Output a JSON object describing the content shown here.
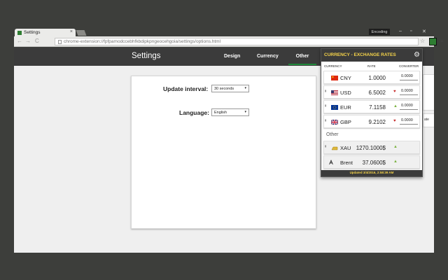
{
  "browser": {
    "tab_title": "Settings",
    "tab_close": "×",
    "profile_label": "Encoding",
    "win_minimize": "–",
    "win_restore": "▫",
    "win_close": "✕",
    "back": "←",
    "forward": "→",
    "reload": "C",
    "url": "chrome-extension://fpfpamodccebhfkbdipkpngeocehgoia/settings/options.html",
    "star": "☆",
    "menu": "≡"
  },
  "app": {
    "title": "Settings",
    "tabs": [
      {
        "label": "Design"
      },
      {
        "label": "Currency"
      },
      {
        "label": "Other"
      }
    ]
  },
  "settings": {
    "update_interval": {
      "label": "Update interval:",
      "value": "30 seconds"
    },
    "language": {
      "label": "Language:",
      "value": "English"
    },
    "caret": "▾"
  },
  "peek": {
    "text": "ate"
  },
  "popup": {
    "title": "CURRENCY - EXCHANGE RATES",
    "gear": "⚙",
    "columns": {
      "currency": "CURRENCY",
      "rate": "RATE",
      "converter": "CONVERTER"
    },
    "rows": [
      {
        "code": "CNY",
        "rate": "1.0000",
        "trend": "",
        "converter": "0.0000"
      },
      {
        "code": "USD",
        "rate": "6.5002",
        "trend": "♥",
        "converter": "0.0000"
      },
      {
        "code": "EUR",
        "rate": "7.1158",
        "trend": "▲",
        "converter": "0.0000"
      },
      {
        "code": "GBP",
        "rate": "9.2102",
        "trend": "♥",
        "converter": "0.0000"
      }
    ],
    "other_label": "Other",
    "other_rows": [
      {
        "code": "XAU",
        "rate": "1270.1000$",
        "trend": "▲"
      },
      {
        "code": "Brent",
        "rate": "37.0600$",
        "trend": "▲"
      }
    ],
    "footer": "Updated 3/4/2016, 2:58:39 AM"
  },
  "colors": {
    "accent_green": "#1f8a3b",
    "title_yellow": "#f6d44a",
    "trend_down": "#c62828",
    "trend_up": "#7cb342"
  }
}
